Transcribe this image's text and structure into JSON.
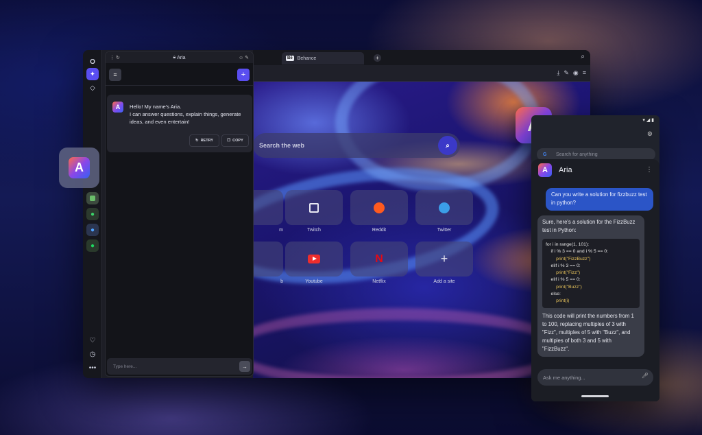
{
  "browser": {
    "address_title": "Aria",
    "tabs": [
      {
        "label": "Behance",
        "badge": "Bē"
      }
    ],
    "new_tab_glyph": "+",
    "rail_icons": [
      "opera-logo-icon",
      "aria-icon",
      "diamond-icon",
      "panel-icon",
      "whatsapp-icon",
      "messenger-icon",
      "spotify-icon",
      "heart-icon",
      "clock-icon",
      "more-icon"
    ]
  },
  "speed_dial": {
    "search_placeholder": "Search the web",
    "tiles": [
      {
        "label": "Twitch",
        "icon": "twitch-icon"
      },
      {
        "label": "Reddit",
        "icon": "reddit-icon"
      },
      {
        "label": "Twitter",
        "icon": "twitter-icon"
      },
      {
        "label": "Youtube",
        "icon": "youtube-icon"
      },
      {
        "label": "Netflix",
        "icon": "netflix-icon"
      },
      {
        "label": "Add a site",
        "icon": "plus-icon"
      }
    ],
    "partial_labels": [
      "m",
      "b"
    ]
  },
  "aria_panel": {
    "greeting": "Hello! My name's Aria.",
    "message": "I can answer questions, explain things, generate ideas, and even entertain!",
    "retry_label": "RETRY",
    "copy_label": "COPY",
    "input_placeholder": "Type here..."
  },
  "phone": {
    "google_placeholder": "Search for anything",
    "chat_title": "Aria",
    "user_message": "Can you write a solution for fizzbuzz test in python?",
    "bot_intro": "Sure, here's a solution for the FizzBuzz test in Python:",
    "code_lines": [
      "for i in range(1, 101):",
      "    if i % 3 == 0 and i % 5 == 0:",
      "        print(\"FizzBuzz\")",
      "    elif i % 3 == 0:",
      "        print(\"Fizz\")",
      "    elif i % 5 == 0:",
      "        print(\"Buzz\")",
      "    else:",
      "        print(i)"
    ],
    "bot_outro": "This code will print the numbers from 1 to 100, replacing multiples of 3 with \"Fizz\", multiples of 5 with \"Buzz\", and multiples of both 3 and 5 with \"FizzBuzz\".",
    "ask_placeholder": "Ask me anything..."
  },
  "colors": {
    "accent": "#5a4ef0",
    "user_bubble": "#2b55c7",
    "aria_gradient_start": "#ff6a4a",
    "aria_gradient_end": "#3560f4"
  }
}
